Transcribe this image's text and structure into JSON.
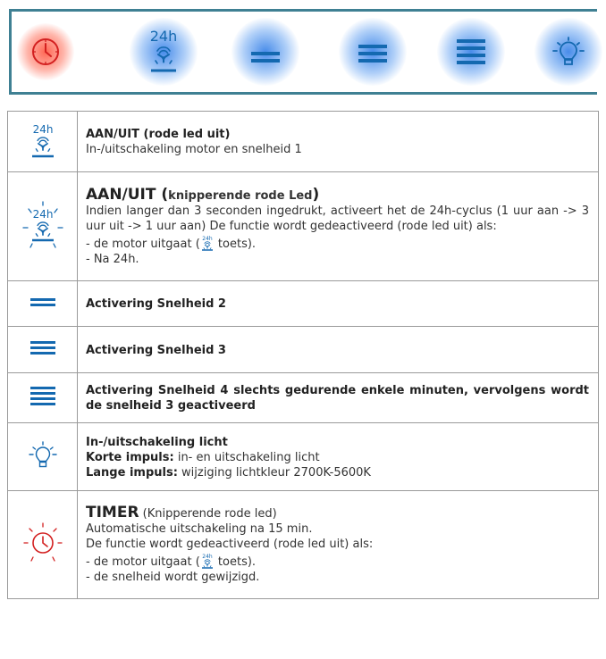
{
  "panel": {
    "buttons": [
      {
        "name": "timer",
        "icon": "clock-icon",
        "glow": "#ff5a46"
      },
      {
        "name": "on-off-24h",
        "icon": "fan-24h-icon",
        "label": "24h",
        "glow": "#2878e6"
      },
      {
        "name": "speed-2",
        "icon": "speed-2-icon",
        "glow": "#2878e6"
      },
      {
        "name": "speed-3",
        "icon": "speed-3-icon",
        "glow": "#2878e6"
      },
      {
        "name": "speed-4",
        "icon": "speed-4-icon",
        "glow": "#2878e6"
      },
      {
        "name": "light",
        "icon": "bulb-icon",
        "glow": "#2878e6"
      }
    ],
    "border_color": "#3f8093",
    "icon_color": "#1469b0"
  },
  "icon_text": "24h",
  "rows": [
    {
      "icon": "fan-24h-icon",
      "title": "AAN/UIT (rode led uit)",
      "body": "In-/uitschakeling motor en snelheid 1"
    },
    {
      "icon": "fan-24h-blinking-icon",
      "title_main": "AAN/UIT (",
      "title_sub": "knipperende rode Led",
      "title_end": ")",
      "body": "Indien langer dan 3 seconden ingedrukt, activeert het de 24h-cyclus (1 uur aan -> 3 uur uit -> 1 uur aan) De functie wordt gedeactiveerd (rode led uit) als:",
      "item1_pre": "- de motor uitgaat (",
      "item1_post": " toets).",
      "item2": "- Na 24h."
    },
    {
      "icon": "speed-2-icon",
      "title": "Activering Snelheid 2"
    },
    {
      "icon": "speed-3-icon",
      "title": "Activering Snelheid 3"
    },
    {
      "icon": "speed-4-icon",
      "title": "Activering Snelheid 4 slechts gedurende enkele minuten, vervolgens wordt de snelheid 3 geactiveerd"
    },
    {
      "icon": "bulb-icon",
      "title": "In-/uitschakeling licht",
      "short_label": "Korte impuls:",
      "short_text": " in- en uitschakeling licht",
      "long_label": "Lange impuls:",
      "long_text": " wijziging lichtkleur 2700K-5600K"
    },
    {
      "icon": "clock-blinking-icon",
      "title": "TIMER",
      "title_note": " (Knipperende rode led)",
      "line1": "Automatische uitschakeling na 15 min.",
      "line2": "De functie wordt gedeactiveerd (rode led uit) als:",
      "item1_pre": "- de motor uitgaat (",
      "item1_post": " toets).",
      "item2": "- de snelheid wordt gewijzigd."
    }
  ]
}
